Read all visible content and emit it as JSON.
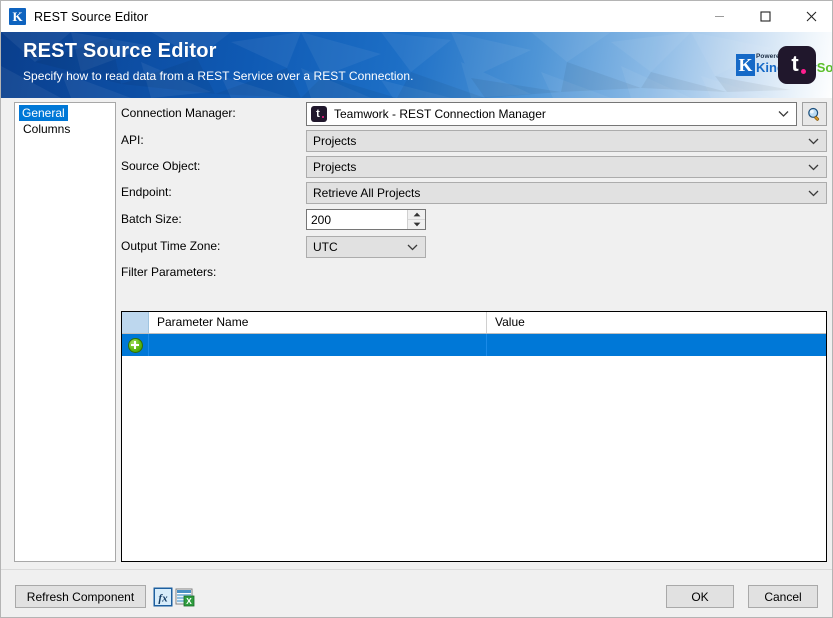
{
  "window": {
    "title": "REST Source Editor",
    "icon": "kingswaysoft-k-icon",
    "controls": {
      "minimize": "minimize-icon",
      "maximize": "maximize-icon",
      "close": "close-icon"
    }
  },
  "banner": {
    "title": "REST Source Editor",
    "subtitle": "Specify how to read data from a REST Service over a REST Connection.",
    "powered_by": "Powered By",
    "brand_first": "Kingsway",
    "brand_second": "Soft",
    "brand_k": "K",
    "product_logo": "teamwork-logo",
    "product_logo_letter": "t",
    "colors": {
      "gradient_start": "#0a3e8c",
      "gradient_end": "#ffffff",
      "brand_blue": "#1569c7",
      "brand_green": "#5bbf2a",
      "teamwork_dark": "#20172c",
      "teamwork_pink": "#ff1f8e"
    }
  },
  "nav": {
    "items": [
      {
        "label": "General",
        "selected": true
      },
      {
        "label": "Columns",
        "selected": false
      }
    ],
    "selected_color": "#0078d7"
  },
  "form": {
    "connection_manager": {
      "label": "Connection Manager:",
      "value": "Teamwork - REST Connection Manager",
      "icon": "teamwork-icon",
      "browse_icon": "magnifier-icon"
    },
    "api": {
      "label": "API:",
      "value": "Projects"
    },
    "source_object": {
      "label": "Source Object:",
      "value": "Projects"
    },
    "endpoint": {
      "label": "Endpoint:",
      "value": "Retrieve All Projects"
    },
    "batch_size": {
      "label": "Batch Size:",
      "value": "200"
    },
    "output_time_zone": {
      "label": "Output Time Zone:",
      "value": "UTC"
    },
    "filter_parameters": {
      "label": "Filter Parameters:"
    }
  },
  "grid": {
    "columns": [
      "Parameter Name",
      "Value"
    ],
    "rows": [
      {
        "row_indicator": "new-row-add-icon",
        "parameter_name": "",
        "value": ""
      }
    ],
    "selected_row_color": "#0078d7",
    "header_corner_color": "#bdd7ee"
  },
  "footer": {
    "refresh_label": "Refresh Component",
    "fx_icon": "expression-fx-icon",
    "export_icon": "spreadsheet-export-icon",
    "ok_label": "OK",
    "cancel_label": "Cancel"
  }
}
